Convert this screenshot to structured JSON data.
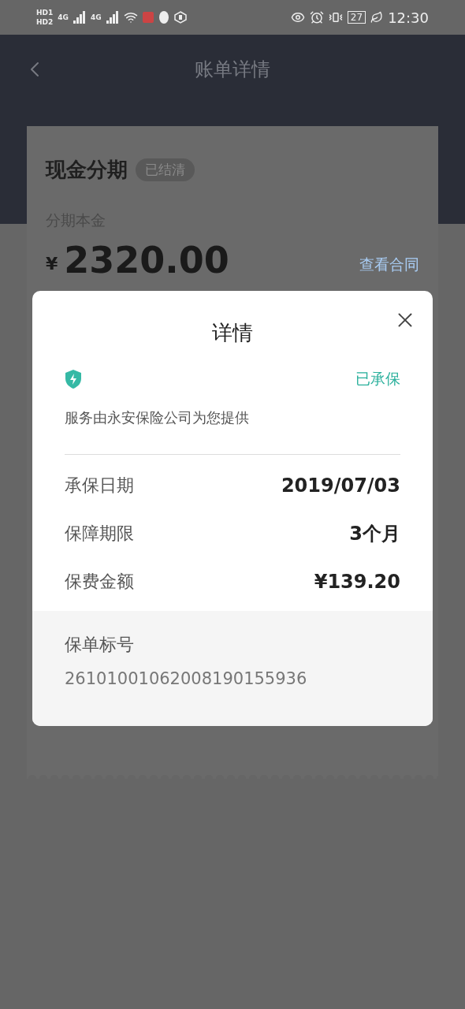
{
  "status_bar": {
    "sim_labels": [
      "HD1",
      "HD2"
    ],
    "network": [
      "4G",
      "4G"
    ],
    "battery": "27",
    "time": "12:30"
  },
  "header": {
    "title": "账单详情"
  },
  "bill_card": {
    "title": "现金分期",
    "badge": "已结清",
    "principal_label": "分期本金",
    "currency": "¥",
    "amount": "2320.00",
    "contract_link": "查看合同"
  },
  "dialog": {
    "title": "详情",
    "status": "已承保",
    "provider": "服务由永安保险公司为您提供",
    "rows": [
      {
        "label": "承保日期",
        "value": "2019/07/03"
      },
      {
        "label": "保障期限",
        "value": "3个月"
      },
      {
        "label": "保费金额",
        "value": "¥139.20"
      }
    ],
    "policy": {
      "label": "保单标号",
      "number": "26101001062008190155936"
    }
  }
}
